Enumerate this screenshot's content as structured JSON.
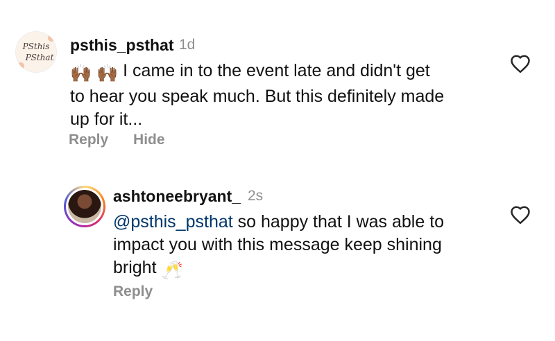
{
  "comments": [
    {
      "username": "psthis_psthat",
      "time": "1d",
      "emoji_prefix": "🙌🏾 🙌🏾",
      "text": "I came in to the event late and didn't get",
      "text2": "to hear you speak much. But this definitely made",
      "text3": "up for it...",
      "actions": {
        "reply": "Reply",
        "hide": "Hide"
      },
      "avatar_label": "PSthis PSthat"
    },
    {
      "username": "ashtoneebryant_",
      "time": "2s",
      "mention": "@psthis_psthat",
      "text": " so happy that I was able to",
      "text2": "impact you with this message keep shining",
      "text3": "bright",
      "emoji_suffix": "🥂",
      "actions": {
        "reply": "Reply"
      }
    }
  ],
  "icons": {
    "like": "heart-outline-icon"
  }
}
